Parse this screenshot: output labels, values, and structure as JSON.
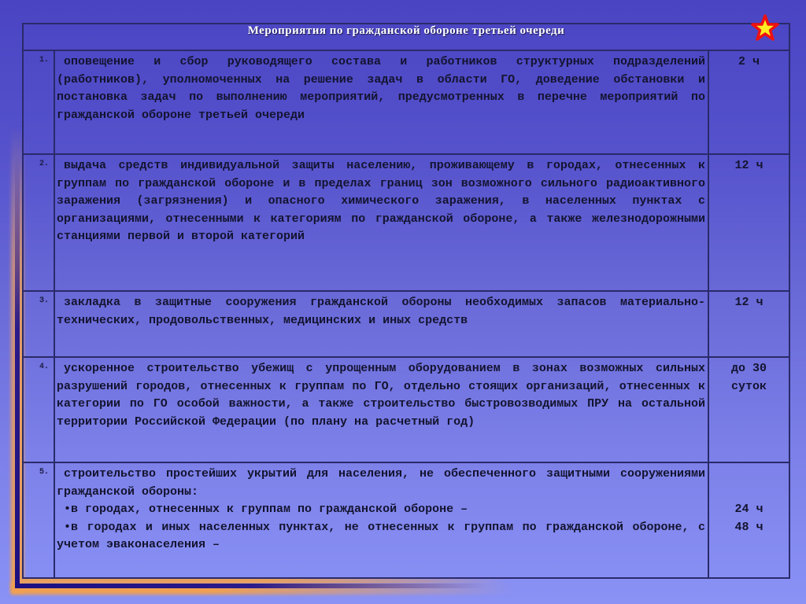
{
  "table": {
    "title": "Мероприятия по гражданской обороне третьей очереди",
    "rows": [
      {
        "number": "1.",
        "paragraphs": [
          "оповещение и сбор руководящего состава и работников структурных подразделений (работников), уполномоченных на решение задач в области ГО, доведение обстановки и постановка задач по выполнению мероприятий, предусмотренных в перечне мероприятий по гражданской обороне третьей очереди"
        ],
        "duration": [
          "2 ч"
        ]
      },
      {
        "number": "2.",
        "paragraphs": [
          "выдача средств индивидуальной защиты населению, проживающему в городах, отнесенных к группам по гражданской обороне и в пределах границ зон возможного сильного радиоактивного заражения (загрязнения) и опасного химического заражения, в населенных пунктах с организациями, отнесенными к категориям по гражданской обороне, а также железнодорожными станциями первой и второй категорий"
        ],
        "duration": [
          "12 ч"
        ]
      },
      {
        "number": "3.",
        "paragraphs": [
          "закладка в защитные сооружения гражданской обороны необходимых запасов материально-технических, продовольственных, медицинских и иных средств"
        ],
        "duration": [
          "12 ч"
        ]
      },
      {
        "number": "4.",
        "paragraphs": [
          "ускоренное строительство убежищ с упрощенным оборудованием в зонах возможных сильных разрушений городов, отнесенных к группам по ГО, отдельно стоящих организаций, отнесенных к категории по ГО особой важности, а также строительство быстровозводимых ПРУ на остальной территории Российской Федерации (по плану на расчетный год)"
        ],
        "duration": [
          "до 30",
          "суток"
        ]
      },
      {
        "number": "5.",
        "paragraphs": [
          "строительство простейших укрытий для населения, не обеспеченного защитными сооружениями гражданской обороны:",
          "•в городах, отнесенных к группам по гражданской обороне –",
          "•в городах и иных населенных пунктах, не отнесенных к группам по гражданской обороне, с учетом эваконаселения –"
        ],
        "duration": [
          "",
          "",
          "24 ч",
          "48 ч"
        ]
      }
    ]
  },
  "colors": {
    "background_top": "#4a44c2",
    "background_bottom": "#8a92f6",
    "border": "#2a2a6a",
    "text": "#141430",
    "title_text": "#ffffff",
    "star_fill": "#ffee22",
    "star_outline": "#ee1111",
    "frame_accent": "#f0a050"
  }
}
